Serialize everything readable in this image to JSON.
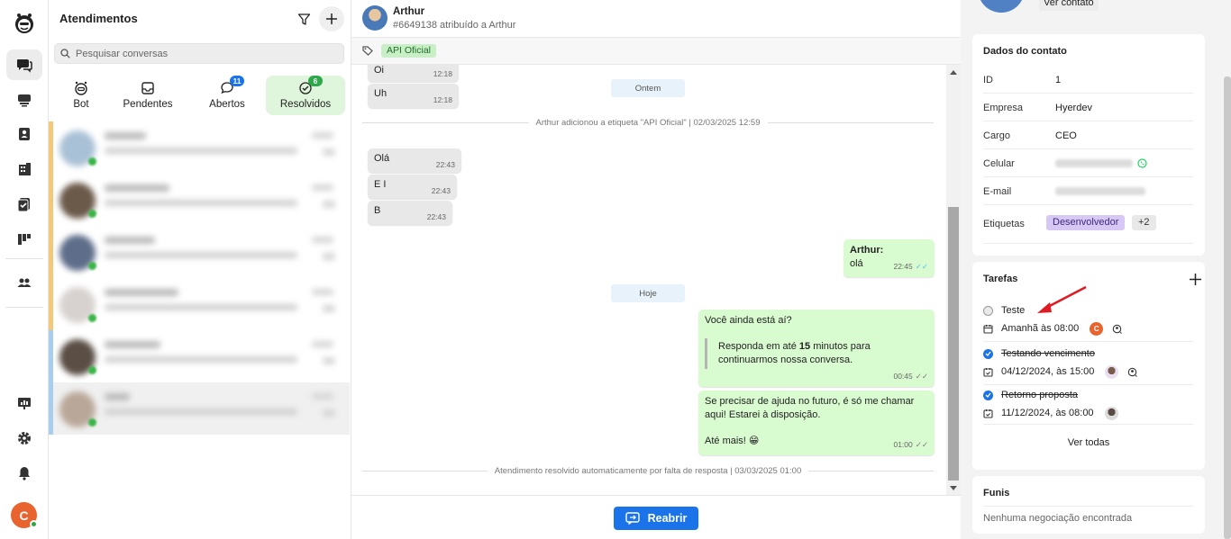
{
  "nav": {
    "items": [
      "logo",
      "chats",
      "inbox",
      "contacts",
      "companies",
      "tasks",
      "kanban",
      "team",
      "reports",
      "settings",
      "notifications"
    ],
    "user_initial": "C"
  },
  "conversations": {
    "title": "Atendimentos",
    "search_placeholder": "Pesquisar conversas",
    "tabs": [
      {
        "label": "Bot",
        "badge": ""
      },
      {
        "label": "Pendentes",
        "badge": ""
      },
      {
        "label": "Abertos",
        "badge": "11"
      },
      {
        "label": "Resolvidos",
        "badge": "6"
      }
    ],
    "colors": {
      "badge_blue": "#1a73e8",
      "badge_green": "#2ea84a",
      "active_tab_bg": "#dff5dc"
    }
  },
  "chat": {
    "contact_name": "Arthur",
    "subtitle": "#6649138 atribuído a Arthur",
    "tag": "API Oficial",
    "pill_ontem": "Ontem",
    "pill_hoje": "Hoje",
    "msg_oi": "Oi",
    "msg_oi_time": "12:18",
    "msg_uh": "Uh",
    "msg_uh_time": "12:18",
    "sys_tag": "Arthur adicionou a etiqueta \"API Oficial\" | 02/03/2025 12:59",
    "msg_ola": "Olá",
    "msg_ola_time": "22:43",
    "msg_ei": "E I",
    "msg_ei_time": "22:43",
    "msg_b": "B",
    "msg_b_time": "22:43",
    "out1_author": "Arthur:",
    "out1_text": "olá",
    "out1_time": "22:45",
    "out2_q": "Você ainda está aí?",
    "out2_quote_a": "Responda em até ",
    "out2_quote_b": "15",
    "out2_quote_c": " minutos para continuarmos nossa conversa.",
    "out2_time": "00:45",
    "out3_a": "Se precisar de ajuda no futuro, é só me chamar aqui! Estarei à disposição.",
    "out3_b": "Até mais! 😁",
    "out3_time": "01:00",
    "sys_resolved": "Atendimento resolvido automaticamente por falta de resposta | 03/03/2025 01:00",
    "reopen": "Reabrir",
    "colors": {
      "out_bubble": "#d9fbd0",
      "in_bubble": "#e8e8e8",
      "tag_bg": "#c9efc6",
      "accent": "#1a73e8"
    }
  },
  "contact": {
    "ver_contato": "Ver contato",
    "section_title": "Dados do contato",
    "fields": [
      {
        "label": "ID",
        "value": "1"
      },
      {
        "label": "Empresa",
        "value": "Hyerdev"
      },
      {
        "label": "Cargo",
        "value": "CEO"
      },
      {
        "label": "Celular",
        "value": ""
      },
      {
        "label": "E-mail",
        "value": ""
      }
    ],
    "tags_label": "Etiquetas",
    "tag1": "Desenvolvedor",
    "tag_more": "+2"
  },
  "tasks": {
    "title": "Tarefas",
    "items": [
      {
        "title": "Teste",
        "date": "Amanhã às 08:00",
        "done": false,
        "assignee": "C"
      },
      {
        "title": "Testando vencimento",
        "date": "04/12/2024, às 15:00",
        "done": true
      },
      {
        "title": "Retorno proposta",
        "date": "11/12/2024, às 08:00",
        "done": true
      }
    ],
    "see_all": "Ver todas"
  },
  "funnels": {
    "title": "Funis",
    "empty": "Nenhuma negociação encontrada"
  }
}
